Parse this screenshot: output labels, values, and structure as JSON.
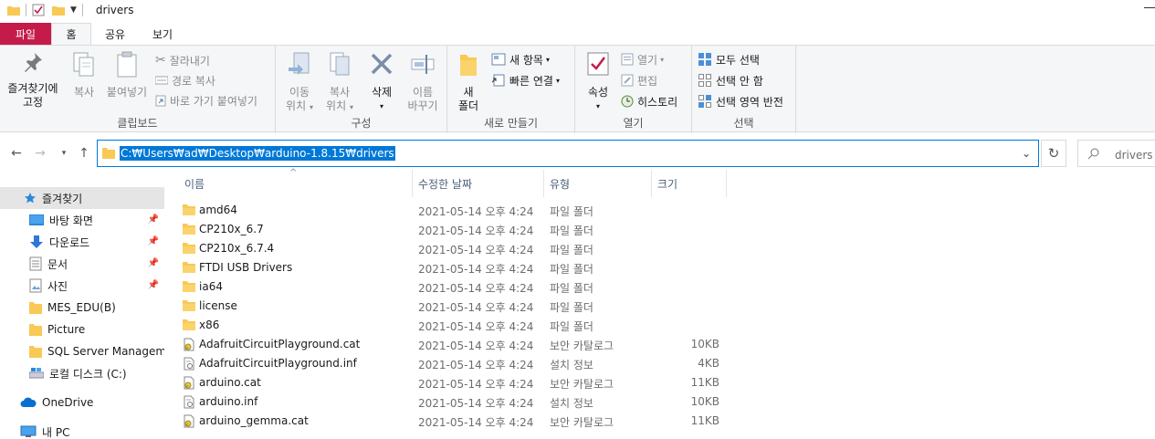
{
  "window": {
    "title": "drivers"
  },
  "tabs": [
    {
      "label": "파일"
    },
    {
      "label": "홈"
    },
    {
      "label": "공유"
    },
    {
      "label": "보기"
    }
  ],
  "ribbon": {
    "clipboard": {
      "pin_label_1": "즐겨찾기에",
      "pin_label_2": "고정",
      "copy": "복사",
      "paste": "붙여넣기",
      "cut": "잘라내기",
      "copy_path": "경로 복사",
      "paste_shortcut": "바로 가기 붙여넣기",
      "group_label": "클립보드"
    },
    "organize": {
      "move_1": "이동",
      "move_2": "위치",
      "copyto_1": "복사",
      "copyto_2": "위치",
      "delete": "삭제",
      "rename_1": "이름",
      "rename_2": "바꾸기",
      "group_label": "구성"
    },
    "new": {
      "newfolder_1": "새",
      "newfolder_2": "폴더",
      "new_item": "새 항목",
      "easy_access": "빠른 연결",
      "group_label": "새로 만들기"
    },
    "open": {
      "properties": "속성",
      "open": "열기",
      "edit": "편집",
      "history": "히스토리",
      "group_label": "열기"
    },
    "select": {
      "select_all": "모두 선택",
      "select_none": "선택 안 함",
      "invert": "선택 영역 반전",
      "group_label": "선택"
    }
  },
  "address": {
    "path": "C:₩Users₩ad₩Desktop₩arduino-1.8.15₩drivers",
    "search_placeholder": "drivers 검"
  },
  "nav": [
    {
      "label": "즐겨찾기",
      "icon": "star-icon",
      "pinned": false
    },
    {
      "label": "바탕 화면",
      "icon": "desktop-icon",
      "pinned": true
    },
    {
      "label": "다운로드",
      "icon": "download-icon",
      "pinned": true
    },
    {
      "label": "문서",
      "icon": "document-icon",
      "pinned": true
    },
    {
      "label": "사진",
      "icon": "pictures-icon",
      "pinned": true
    },
    {
      "label": "MES_EDU(B)",
      "icon": "folder-icon",
      "pinned": false
    },
    {
      "label": "Picture",
      "icon": "folder-icon",
      "pinned": false
    },
    {
      "label": "SQL Server Manageme",
      "icon": "folder-icon",
      "pinned": false
    },
    {
      "label": "로컬 디스크 (C:)",
      "icon": "drive-icon",
      "pinned": false
    },
    {
      "label": "OneDrive",
      "icon": "cloud-icon",
      "pinned": false
    },
    {
      "label": "내 PC",
      "icon": "pc-icon",
      "pinned": false
    }
  ],
  "columns": {
    "name": "이름",
    "date": "수정한 날짜",
    "type": "유형",
    "size": "크기"
  },
  "files": [
    {
      "name": "amd64",
      "date": "2021-05-14 오후 4:24",
      "type": "파일 폴더",
      "size": "",
      "kind": "folder"
    },
    {
      "name": "CP210x_6.7",
      "date": "2021-05-14 오후 4:24",
      "type": "파일 폴더",
      "size": "",
      "kind": "folder"
    },
    {
      "name": "CP210x_6.7.4",
      "date": "2021-05-14 오후 4:24",
      "type": "파일 폴더",
      "size": "",
      "kind": "folder"
    },
    {
      "name": "FTDI USB Drivers",
      "date": "2021-05-14 오후 4:24",
      "type": "파일 폴더",
      "size": "",
      "kind": "folder"
    },
    {
      "name": "ia64",
      "date": "2021-05-14 오후 4:24",
      "type": "파일 폴더",
      "size": "",
      "kind": "folder"
    },
    {
      "name": "license",
      "date": "2021-05-14 오후 4:24",
      "type": "파일 폴더",
      "size": "",
      "kind": "folder"
    },
    {
      "name": "x86",
      "date": "2021-05-14 오후 4:24",
      "type": "파일 폴더",
      "size": "",
      "kind": "folder"
    },
    {
      "name": "AdafruitCircuitPlayground.cat",
      "date": "2021-05-14 오후 4:24",
      "type": "보안 카탈로그",
      "size": "10KB",
      "kind": "cat"
    },
    {
      "name": "AdafruitCircuitPlayground.inf",
      "date": "2021-05-14 오후 4:24",
      "type": "설치 정보",
      "size": "4KB",
      "kind": "inf"
    },
    {
      "name": "arduino.cat",
      "date": "2021-05-14 오후 4:24",
      "type": "보안 카탈로그",
      "size": "11KB",
      "kind": "cat"
    },
    {
      "name": "arduino.inf",
      "date": "2021-05-14 오후 4:24",
      "type": "설치 정보",
      "size": "10KB",
      "kind": "inf"
    },
    {
      "name": "arduino_gemma.cat",
      "date": "2021-05-14 오후 4:24",
      "type": "보안 카탈로그",
      "size": "11KB",
      "kind": "cat"
    }
  ],
  "colors": {
    "accent": "#0078d7",
    "file_tab": "#c51b4a",
    "folder": "#f8c954"
  }
}
